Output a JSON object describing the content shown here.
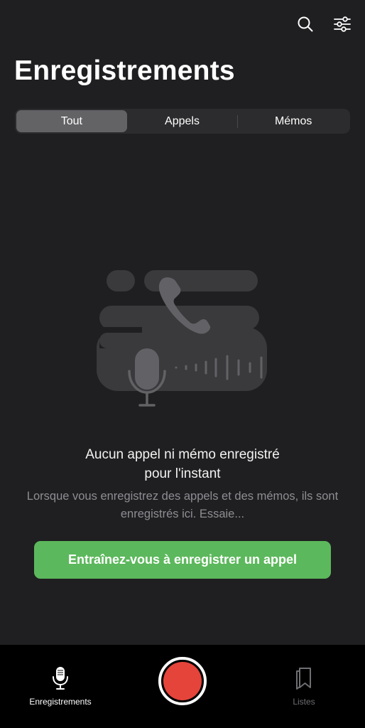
{
  "header": {
    "title": "Enregistrements",
    "icons": [
      "search-icon",
      "filter-sliders-icon"
    ]
  },
  "segments": [
    {
      "label": "Tout",
      "selected": true
    },
    {
      "label": "Appels",
      "selected": false
    },
    {
      "label": "Mémos",
      "selected": false
    }
  ],
  "empty_state": {
    "illustration": "phone-and-microphone-illustration",
    "title_line1": "Aucun appel ni mémo enregistré",
    "title_line2": "pour l'instant",
    "description": "Lorsque vous enregistrez des appels et des mémos, ils sont enregistrés ici. Essaie...",
    "cta_label": "Entraînez-vous à enregistrer un appel"
  },
  "tabbar": {
    "recordings_label": "Enregistrements",
    "lists_label": "Listes",
    "record_button": "record-icon"
  },
  "colors": {
    "background": "#1f1f21",
    "accent_green": "#5cb85c",
    "record_red": "#e5443b",
    "segment_active": "#636366",
    "tabbar_bg": "#000000"
  }
}
